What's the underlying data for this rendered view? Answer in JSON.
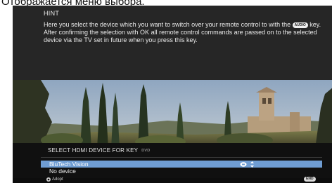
{
  "page_caption": "Отображается меню выбора.",
  "hint": {
    "title": "HINT",
    "text_before_key": "Here you select the device which you want to switch over your remote control to with the ",
    "key_badge": "AUDIO",
    "text_after_key": " key. After confirming the selection with OK all remote control commands are passed on to the selected device via the TV set in future when you press this key."
  },
  "menu": {
    "title": "SELECT HDMI DEVICE FOR KEY",
    "key_label": "DVD",
    "items": [
      {
        "label": "BluTech Vision",
        "selected": true
      },
      {
        "label": "No device",
        "selected": false
      }
    ],
    "selection_icons": [
      "ok-circle-icon",
      "up-down-arrows-icon"
    ]
  },
  "footer": {
    "adopt_label": "Adopt",
    "end_key": "END"
  },
  "colors": {
    "hint_bg": "#262626",
    "menu_bg": "#101010",
    "selection": "#6f9dd3"
  }
}
